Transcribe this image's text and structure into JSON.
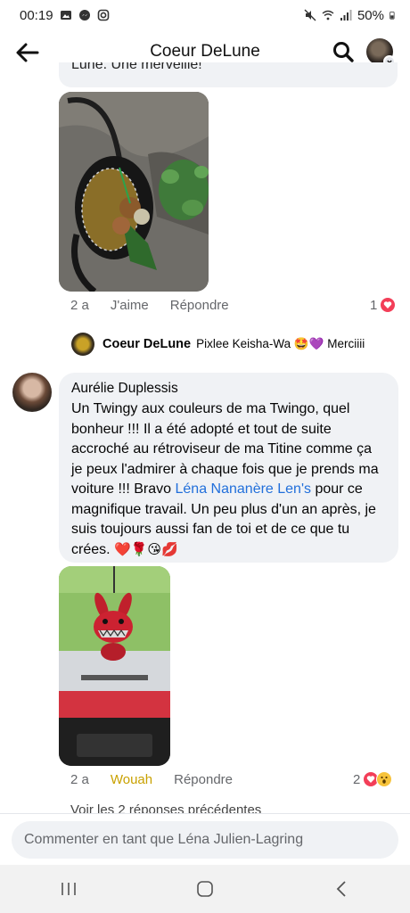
{
  "status_bar": {
    "time": "00:19",
    "battery": "50%",
    "icons": [
      "image-icon",
      "messenger-icon",
      "instagram-icon",
      "mute-icon",
      "wifi-icon",
      "signal-icon",
      "battery-icon"
    ]
  },
  "header": {
    "title": "Coeur DeLune",
    "back_icon": "arrow-left-icon",
    "search_icon": "search-icon"
  },
  "previous_comment": {
    "cut_text": "Lune. Une merveille!"
  },
  "post1": {
    "time": "2 a",
    "like_label": "J'aime",
    "reply_label": "Répondre",
    "reaction_count": "1",
    "reaction_icons": [
      "love-icon"
    ]
  },
  "reply": {
    "author": "Coeur DeLune",
    "text": "Pixlee Keisha-Wa 🤩💜 Merciiii"
  },
  "comment": {
    "author": "Aurélie Duplessis",
    "text_before": "Un Twingy aux couleurs de ma Twingo, quel bonheur !!! Il a été adopté et tout de suite accroché au rétroviseur de ma Titine comme ça je peux l'admirer à chaque fois que je prends ma voiture  !!! Bravo ",
    "mention": "Léna Nananère Len's",
    "text_after": " pour ce magnifique travail. Un peu plus d'un an après, je suis toujours aussi fan de toi et de ce que tu crées. ",
    "emojis": "❤️🌹😘💋"
  },
  "post2": {
    "time": "2 a",
    "like_label": "Wouah",
    "reply_label": "Répondre",
    "reaction_count": "2",
    "reaction_icons": [
      "love-icon",
      "wow-icon"
    ]
  },
  "view_replies": "Voir les 2 réponses précédentes",
  "composer": {
    "placeholder": "Commenter en tant que Léna Julien-Lagring"
  },
  "colors": {
    "accent_blue": "#216fdb",
    "wow_yellow": "#c9a100",
    "love_red": "#f33e58",
    "bubble_bg": "#f0f2f5"
  }
}
